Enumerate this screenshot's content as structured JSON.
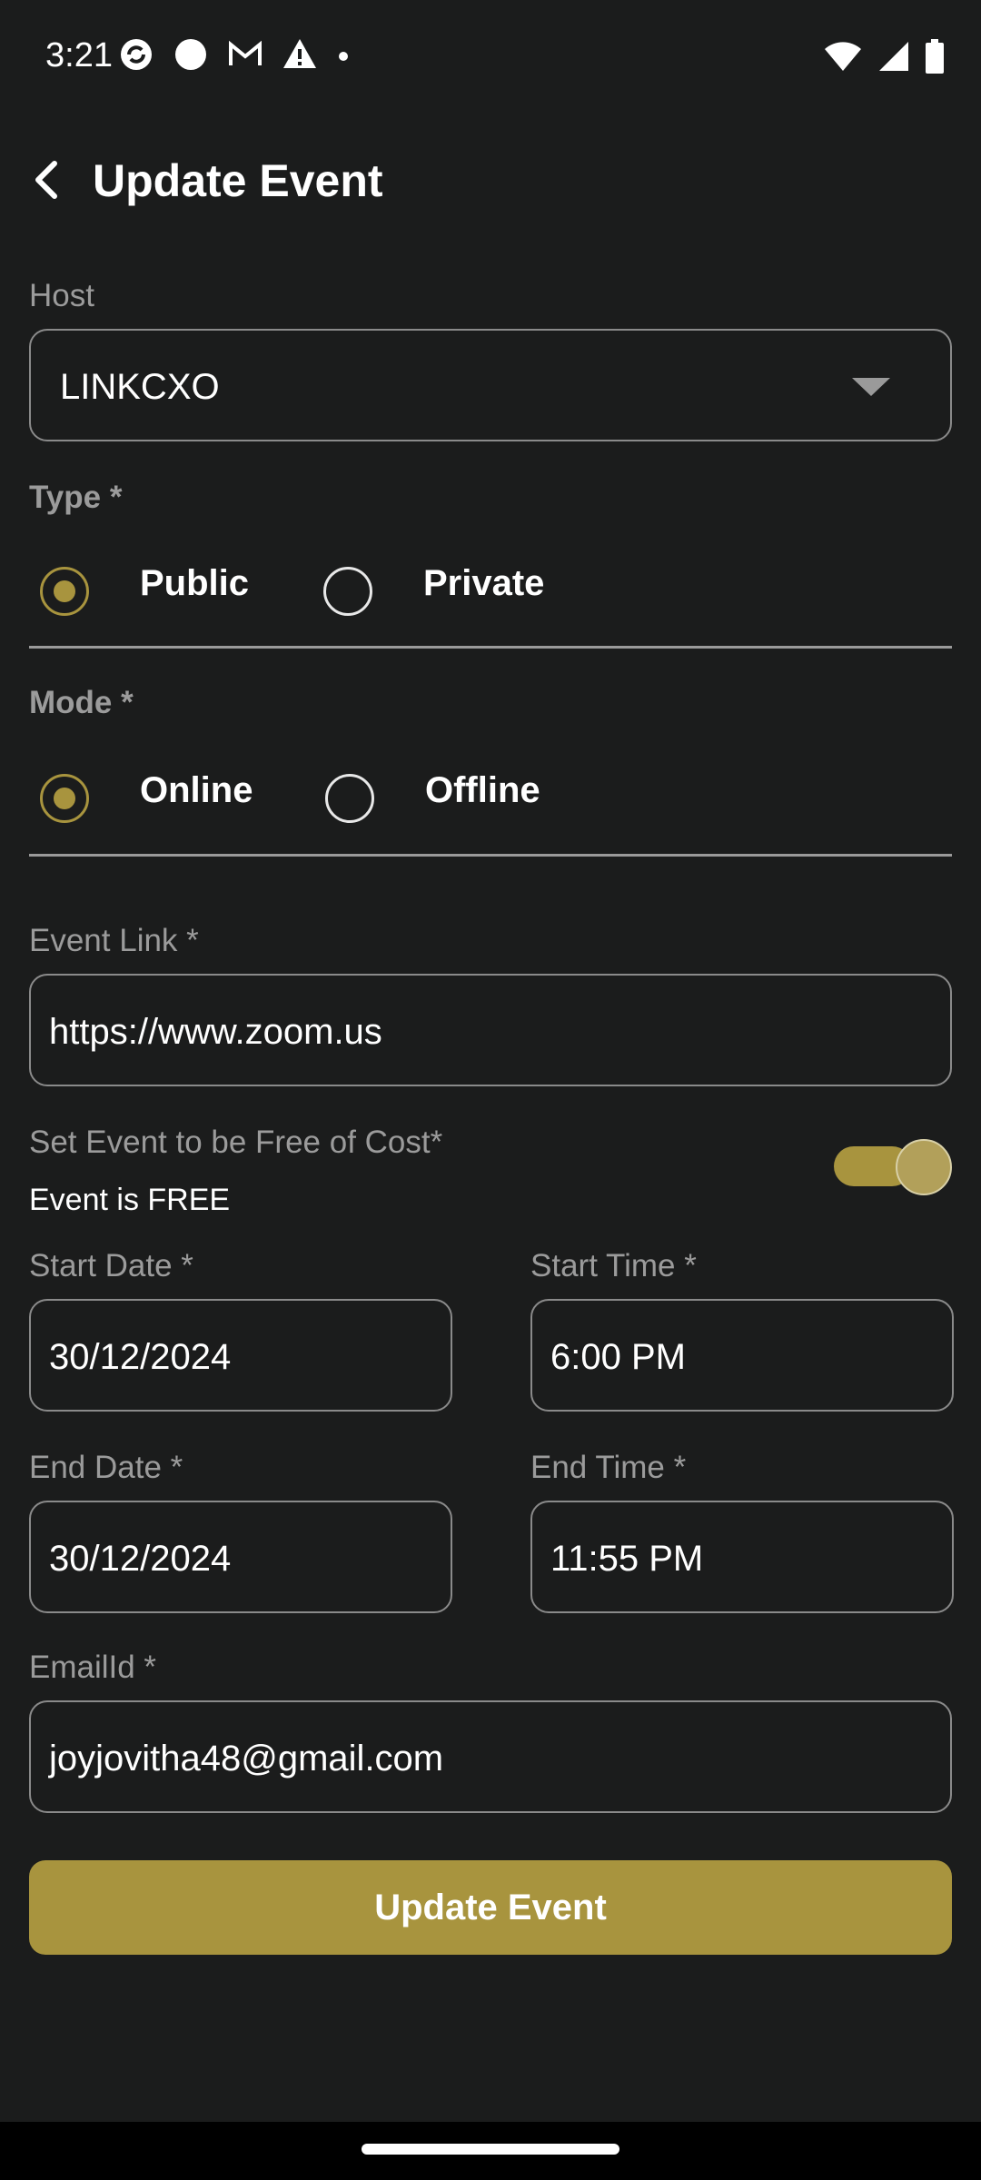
{
  "status_bar": {
    "time": "3:21",
    "left_icons": [
      "sync-icon",
      "circle-icon",
      "gmail-icon",
      "warning-icon",
      "dot-icon"
    ],
    "right_icons": [
      "wifi-icon",
      "signal-icon",
      "battery-icon"
    ]
  },
  "header": {
    "title": "Update Event"
  },
  "host": {
    "label": "Host",
    "value": "LINKCXO"
  },
  "type": {
    "label": "Type *",
    "options": [
      "Public",
      "Private"
    ],
    "selected": "Public"
  },
  "mode": {
    "label": "Mode *",
    "options": [
      "Online",
      "Offline"
    ],
    "selected": "Online"
  },
  "event_link": {
    "label": "Event Link *",
    "value": "https://www.zoom.us"
  },
  "free_of_cost": {
    "label": "Set Event to be Free of Cost*",
    "status": "Event is FREE",
    "enabled": true
  },
  "start_date": {
    "label": "Start Date *",
    "value": "30/12/2024"
  },
  "start_time": {
    "label": "Start Time *",
    "value": "6:00 PM"
  },
  "end_date": {
    "label": "End Date *",
    "value": "30/12/2024"
  },
  "end_time": {
    "label": "End Time *",
    "value": "11:55 PM"
  },
  "email": {
    "label": "EmailId *",
    "value": "joyjovitha48@gmail.com"
  },
  "submit": {
    "label": "Update Event"
  },
  "colors": {
    "background": "#1b1c1c",
    "accent": "#a8943e",
    "label": "#9b9b9b",
    "border": "#8a8a8a"
  }
}
